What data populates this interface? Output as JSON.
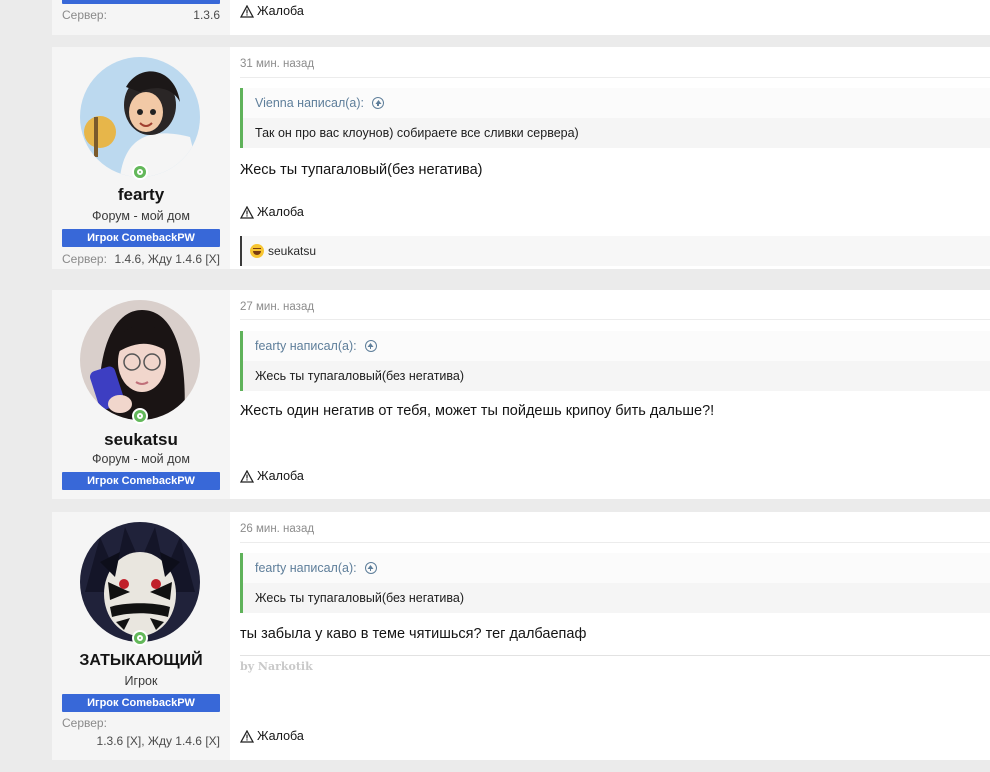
{
  "top_partial": {
    "server_label": "Сервер:",
    "server_value": "1.3.6",
    "report_label": "Жалоба"
  },
  "posts": [
    {
      "username": "fearty",
      "user_title": "Форум - мой дом",
      "banner": "Игрок ComebackPW",
      "server_label": "Сервер:",
      "server_value": "1.4.6, Жду 1.4.6 [X]",
      "date": "31 мин. назад",
      "quote_author": "Vienna написал(а):",
      "quote_text": "Так он про вас клоунов) собираете все сливки сервера)",
      "message": "Жесь ты тупагаловый(без негатива)",
      "report_label": "Жалоба",
      "reaction_user": "seukatsu"
    },
    {
      "username": "seukatsu",
      "user_title": "Форум - мой дом",
      "banner": "Игрок ComebackPW",
      "date": "27 мин. назад",
      "quote_author": "fearty написал(а):",
      "quote_text": "Жесь ты тупагаловый(без негатива)",
      "message": "Жесть один негатив от тебя, может ты пойдешь крипоу бить дальше?!",
      "report_label": "Жалоба"
    },
    {
      "username": "ЗАТЫКАЮЩИЙ",
      "user_title": "Игрок",
      "banner": "Игрок ComebackPW",
      "server_label": "Сервер:",
      "server_value": "1.3.6 [X], Жду 1.4.6 [X]",
      "date": "26 мин. назад",
      "quote_author": "fearty написал(а):",
      "quote_text": "Жесь ты тупагаловый(без негатива)",
      "message": "ты забыла у каво в теме чятишься? тег далбаепаф",
      "signature": "by Narkotik",
      "report_label": "Жалоба"
    }
  ],
  "colors": {
    "banner_bg": "#3868d8",
    "quote_border": "#5fb25a",
    "online": "#63b85a"
  }
}
